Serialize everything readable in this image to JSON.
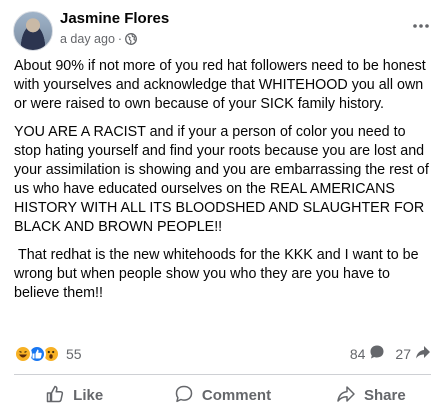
{
  "post": {
    "author": "Jasmine Flores",
    "timestamp": "a day ago",
    "audience_icon": "globe-icon",
    "more_icon": "more-options-icon",
    "paragraphs": [
      "About 90% if not more of you red hat followers need to be honest with yourselves and acknowledge that WHITEHOOD you all own or were raised to own because of your SICK family history.",
      "YOU ARE A RACIST and if your a person of color you need to stop hating yourself and find your roots because you are lost and your assimilation is showing and you are embarrassing the rest of us who have educated ourselves on the REAL AMERICANS HISTORY WITH ALL ITS BLOODSHED AND SLAUGHTER FOR BLACK AND BROWN PEOPLE!!",
      " That redhat is the new whitehoods for the KKK and I want to be wrong but when people show you who they are you have to believe them!!"
    ]
  },
  "engagement": {
    "reaction_icons": [
      "haha-icon",
      "like-icon",
      "wow-icon"
    ],
    "reaction_count": "55",
    "comment_count": "84",
    "share_count": "27"
  },
  "actions": {
    "like_label": "Like",
    "comment_label": "Comment",
    "share_label": "Share"
  },
  "colors": {
    "like_blue": "#1877f2",
    "reaction_yellow": "#f7b125",
    "secondary_text": "#65676b",
    "divider": "#ced0d4"
  }
}
